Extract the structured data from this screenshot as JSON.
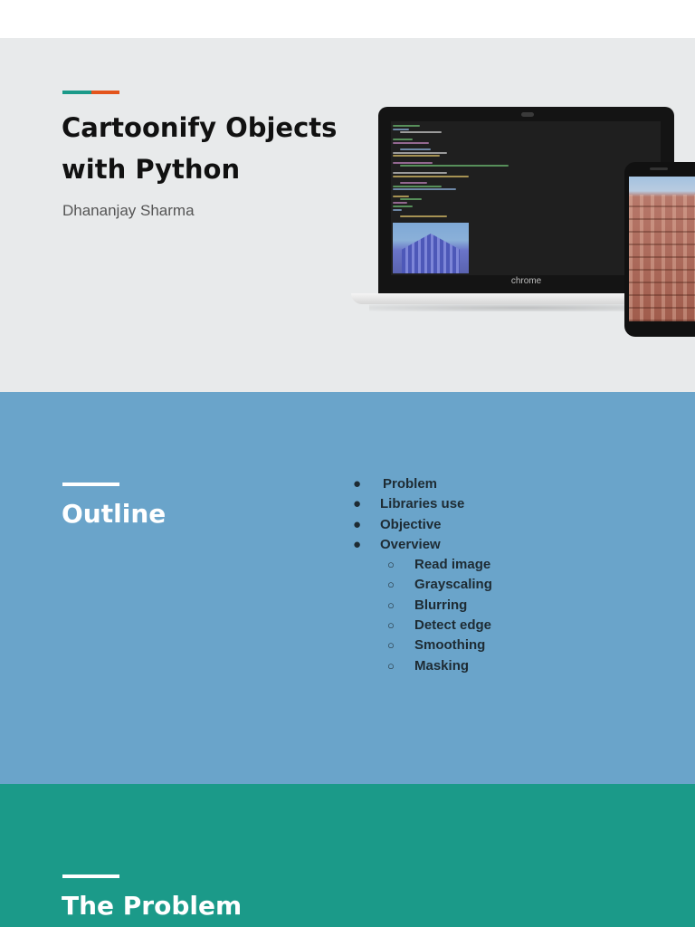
{
  "colors": {
    "accent_teal": "#1b9a89",
    "accent_orange": "#e3541c",
    "outline_bg": "#6aa4ca",
    "problem_bg": "#1b9a89",
    "title_bg": "#e8eaeb"
  },
  "title_slide": {
    "title_line1": "Cartoonify Objects",
    "title_line2": "with Python",
    "author": "Dhananjay Sharma",
    "laptop_brand": "chrome"
  },
  "outline_slide": {
    "title": "Outline",
    "bullet_glyph": "●",
    "sub_bullet_glyph": "○",
    "items": [
      {
        "label": "Problem"
      },
      {
        "label": "Libraries use"
      },
      {
        "label": "Objective"
      },
      {
        "label": "Overview"
      }
    ],
    "subitems": [
      {
        "label": "Read image"
      },
      {
        "label": "Grayscaling"
      },
      {
        "label": "Blurring"
      },
      {
        "label": "Detect edge"
      },
      {
        "label": "Smoothing"
      },
      {
        "label": "Masking"
      }
    ]
  },
  "problem_slide": {
    "title": "The Problem"
  }
}
